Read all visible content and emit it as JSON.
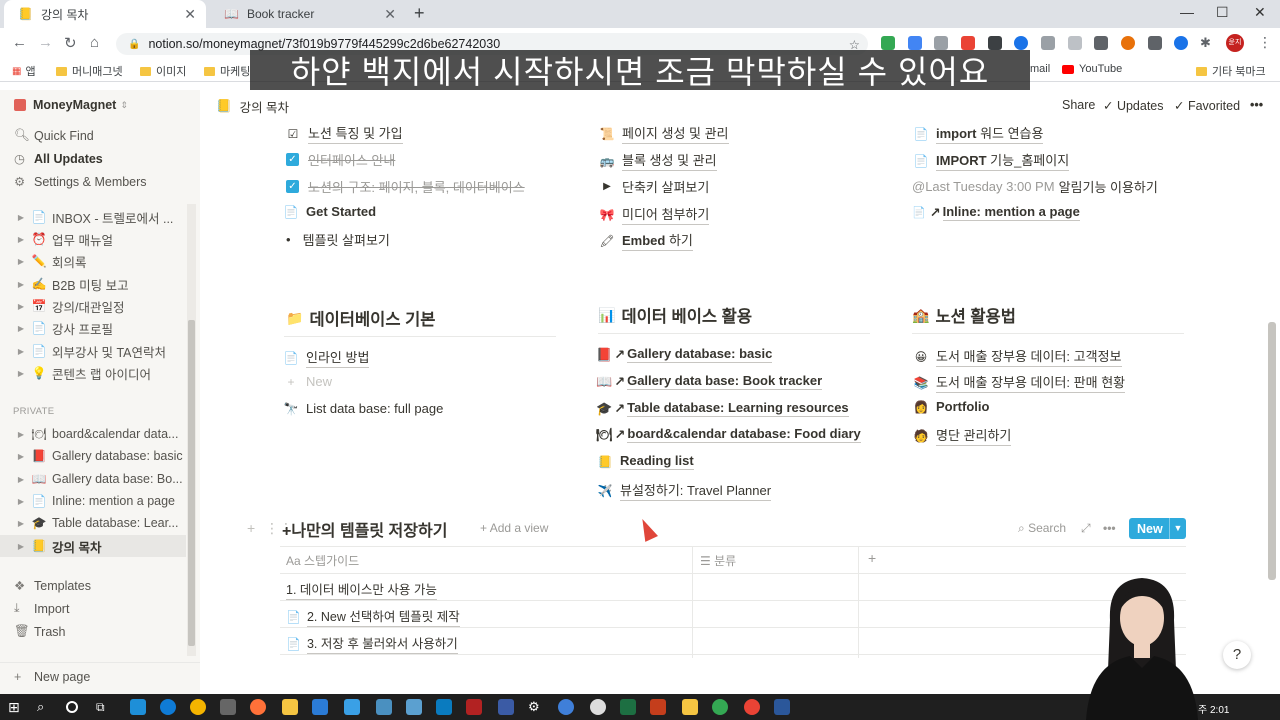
{
  "browser": {
    "tabs": [
      {
        "title": "강의 목차",
        "active": true
      },
      {
        "title": "Book tracker",
        "active": false
      }
    ],
    "url": "notion.so/moneymagnet/73f019b9779f445299c2d6be62742030",
    "bookmarks": {
      "apps": "앱",
      "items": [
        "머니매그넷",
        "이미지",
        "마케팅"
      ],
      "right": [
        "mail",
        "YouTube"
      ],
      "other": "기타 북마크"
    },
    "profile_text": "윤지"
  },
  "caption": "하얀 백지에서 시작하시면 조금 막막하실 수 있어요",
  "sidebar": {
    "workspace": "MoneyMagnet",
    "quick_find": "Quick Find",
    "all_updates": "All Updates",
    "settings": "Settings & Members",
    "pages": [
      {
        "label": "INBOX - 트렐로에서 ...",
        "icon": "📄"
      },
      {
        "label": "업무 매뉴얼",
        "icon": "⏰"
      },
      {
        "label": "회의록",
        "icon": "✏️"
      },
      {
        "label": "B2B 미팅 보고",
        "icon": "✍️"
      },
      {
        "label": "강의/대관일정",
        "icon": "📅"
      },
      {
        "label": "강사 프로필",
        "icon": "📄"
      },
      {
        "label": "외부강사 및 TA연락처",
        "icon": "📄"
      },
      {
        "label": "콘텐츠 랩 아이디어",
        "icon": "💡"
      }
    ],
    "private_label": "PRIVATE",
    "private_pages": [
      {
        "label": "board&calendar data...",
        "icon": "🍽"
      },
      {
        "label": "Gallery database: basic",
        "icon": "📕"
      },
      {
        "label": "Gallery data base: Bo...",
        "icon": "📖"
      },
      {
        "label": "Inline: mention a page",
        "icon": "📄"
      },
      {
        "label": "Table database: Lear...",
        "icon": "🎓"
      },
      {
        "label": "강의 목차",
        "icon": "📒"
      }
    ],
    "templates": "Templates",
    "import": "Import",
    "trash": "Trash",
    "new_page": "New page"
  },
  "topbar": {
    "breadcrumb": "강의 목차",
    "share": "Share",
    "updates": "Updates",
    "favorited": "Favorited"
  },
  "col1": {
    "items": [
      {
        "text": "노션 특징 및 가입",
        "icon": "✓"
      },
      {
        "text": "인터페이스 안내",
        "checked": true
      },
      {
        "text": "노션의 구조: 페이지, 블록, 데이터베이스",
        "checked": true
      },
      {
        "text": "Get Started",
        "icon": "📄"
      },
      {
        "text": "템플릿 살펴보기",
        "bullet": true
      }
    ],
    "heading": "데이터베이스 기본",
    "heading_icon": "📁",
    "items2": [
      {
        "text": "인라인 방법",
        "icon": "📄"
      },
      {
        "text": "New",
        "placeholder": true
      },
      {
        "text": "List data base: full page",
        "icon": "🔭"
      }
    ]
  },
  "col2": {
    "items": [
      {
        "text": "페이지 생성 및 관리",
        "icon": "📜"
      },
      {
        "text": "블록 생성 및 관리",
        "icon": "🚌"
      },
      {
        "text": "단축키 살펴보기",
        "icon": "▶"
      },
      {
        "text": "미디어 첨부하기",
        "icon": "🎀"
      },
      {
        "text_a": "Embed",
        "text_b": " 하기",
        "icon": "🖍"
      }
    ],
    "heading": "데이터 베이스 활용",
    "heading_icon": "📊",
    "items2": [
      {
        "text": "Gallery database: basic",
        "icon": "📕"
      },
      {
        "text": "Gallery data base: Book tracker",
        "icon": "📖"
      },
      {
        "text": "Table database: Learning resources",
        "icon": "🎓"
      },
      {
        "text": "board&calendar database: Food diary",
        "icon": "🍽"
      },
      {
        "text": "Reading list",
        "icon": "📒"
      },
      {
        "text": "뷰설정하기: Travel Planner",
        "icon": "✈️"
      }
    ]
  },
  "col3": {
    "items": [
      {
        "text_a": "import",
        "text_b": " 워드 연습용",
        "icon": "📄"
      },
      {
        "text_a": "IMPORT",
        "text_b": " 기능_홈페이지",
        "icon": "📄"
      },
      {
        "mention": "@Last Tuesday 3:00 PM",
        "text": "알림기능 이용하기"
      },
      {
        "text": "Inline: mention a page",
        "icon": "📄"
      }
    ],
    "heading": "노션 활용법",
    "heading_icon": "🏫",
    "items2": [
      {
        "text": "도서 매출 장부용 데이터: 고객정보",
        "icon": "😀"
      },
      {
        "text": "도서 매출 장부용 데이터: 판매 현황",
        "icon": "📚"
      },
      {
        "text": "Portfolio",
        "icon": "👩"
      },
      {
        "text": "명단 관리하기",
        "icon": "🧑"
      }
    ]
  },
  "database": {
    "title": "+나만의 템플릿 저장하기",
    "add_view": "Add a view",
    "search": "Search",
    "new": "New",
    "columns": [
      "스텝가이드",
      "분류"
    ],
    "rows": [
      {
        "text": "1. 데이터 베이스만 사용 가능",
        "icon": ""
      },
      {
        "text": "2. New 선택하여 템플릿 제작",
        "icon": "📄"
      },
      {
        "text": "3. 저장 후 불러와서 사용하기",
        "icon": "📄"
      }
    ]
  },
  "taskbar": {
    "time": "2:01"
  }
}
